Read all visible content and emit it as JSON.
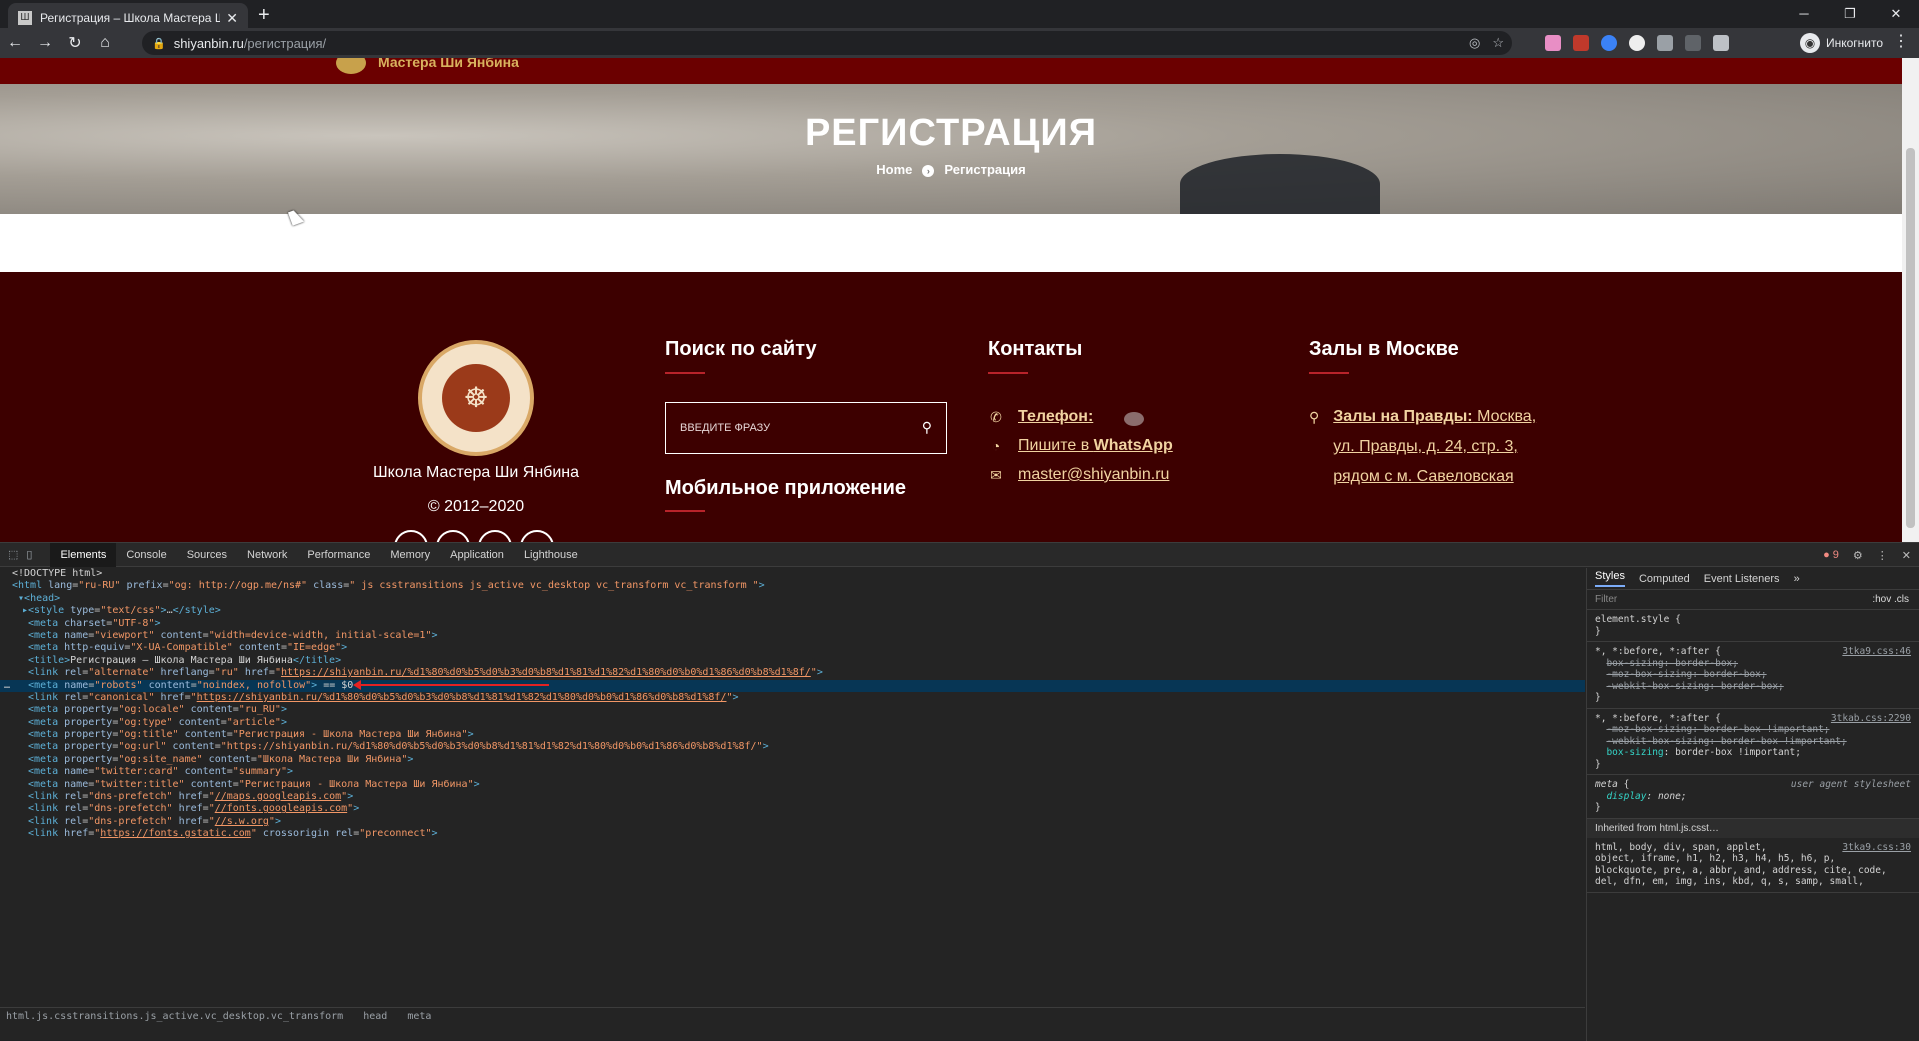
{
  "browser": {
    "tab_title": "Регистрация – Школа Мастера Ши",
    "url_host": "shiyanbin.ru",
    "url_path": "/регистрация/",
    "profile_label": "Инкогнито"
  },
  "site": {
    "header_name": "Мастера Ши Янбина",
    "page_title": "РЕГИСТРАЦИЯ",
    "breadcrumb_home": "Home",
    "breadcrumb_current": "Регистрация",
    "school_name": "Школа Мастера Ши Янбина",
    "copyright": "© 2012–2020",
    "search_heading": "Поиск по сайту",
    "search_placeholder": "ВВЕДИТЕ ФРАЗУ",
    "mobile_heading": "Мобильное приложение",
    "contacts_heading": "Контакты",
    "phone_label": "Телефон:",
    "whatsapp_prefix": "Пишите в ",
    "whatsapp_name": "WhatsApp",
    "email": "master@shiyanbin.ru",
    "halls_heading": "Залы в Москве",
    "hall_name": "Залы на Правды:",
    "hall_line1": " Москва,",
    "hall_line2": "ул. Правды, д. 24, стр. 3,",
    "hall_line3": "рядом с м. Савеловская"
  },
  "devtools": {
    "tabs": [
      "Elements",
      "Console",
      "Sources",
      "Network",
      "Performance",
      "Memory",
      "Application",
      "Lighthouse"
    ],
    "error_count": "9",
    "styles_tabs": [
      "Styles",
      "Computed",
      "Event Listeners"
    ],
    "filter_placeholder": "Filter",
    "filter_opts": ":hov  .cls",
    "breadcrumb": [
      "html.js.csstransitions.js_active.vc_desktop.vc_transform",
      "head",
      "meta"
    ]
  }
}
